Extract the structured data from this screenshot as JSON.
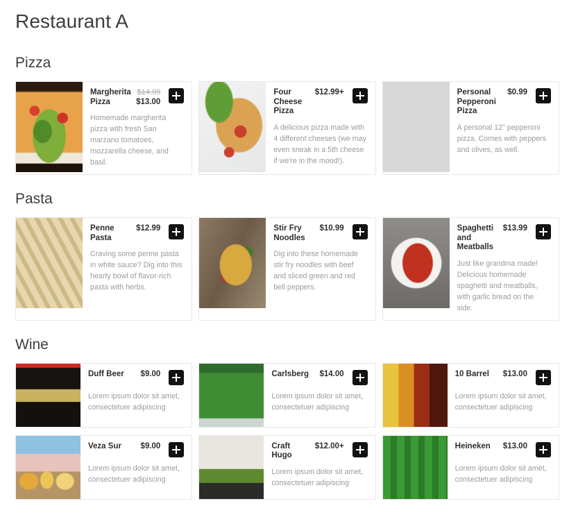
{
  "restaurant": {
    "title": "Restaurant A"
  },
  "add_button_label": "+",
  "sections": [
    {
      "id": "pizza",
      "title": "Pizza",
      "card_size": "tall",
      "items": [
        {
          "name": "Margherita Pizza",
          "price": "$13.00",
          "old_price": "$14.99",
          "description": "Homemade margherita pizza with fresh San marzano tomatoes, mozzarella cheese, and basil.",
          "thumb": "margherita"
        },
        {
          "name": "Four Cheese Pizza",
          "price": "$12.99+",
          "old_price": "",
          "description": "A delicious pizza made with 4 different cheeses (we may even sneak in a 5th cheese if we're in the mood!).",
          "thumb": "fourcheese"
        },
        {
          "name": "Personal Pepperoni Pizza",
          "price": "$0.99",
          "old_price": "",
          "description": "A personal 12\" pepperoni pizza. Comes with peppers and olives, as well.",
          "thumb": "pepperoni"
        }
      ]
    },
    {
      "id": "pasta",
      "title": "Pasta",
      "card_size": "tall",
      "items": [
        {
          "name": "Penne Pasta",
          "price": "$12.99",
          "old_price": "",
          "description": "Craving some penne pasta in white sauce? Dig into this hearty bowl of flavor-rich pasta with herbs.",
          "thumb": "penne"
        },
        {
          "name": "Stir Fry Noodles",
          "price": "$10.99",
          "old_price": "",
          "description": "Dig into these homemade stir fry noodles with beef and sliced green and red bell peppers.",
          "thumb": "stirfry"
        },
        {
          "name": "Spaghetti and Meatballs",
          "price": "$13.99",
          "old_price": "",
          "description": "Just like grandma made! Delicious homemade spaghetti and meatballs, with garlic bread on the side.",
          "thumb": "spaghetti"
        }
      ]
    },
    {
      "id": "wine",
      "title": "Wine",
      "card_size": "short",
      "items": [
        {
          "name": "Duff Beer",
          "price": "$9.00",
          "old_price": "",
          "description": "Lorem ipsum dolor sit amet, consectetuer adipiscing",
          "thumb": "duff"
        },
        {
          "name": "Carlsberg",
          "price": "$14.00",
          "old_price": "",
          "description": "Lorem ipsum dolor sit amet, consectetuer adipiscing",
          "thumb": "carlsberg"
        },
        {
          "name": "10 Barrel",
          "price": "$13.00",
          "old_price": "",
          "description": "Lorem ipsum dolor sit amet, consectetuer adipiscing",
          "thumb": "10barrel"
        },
        {
          "name": "Veza Sur",
          "price": "$9.00",
          "old_price": "",
          "description": "Lorem ipsum dolor sit amet, consectetuer adipiscing",
          "thumb": "vezasur"
        },
        {
          "name": "Craft Hugo",
          "price": "$12.00+",
          "old_price": "",
          "description": "Lorem ipsum dolor sit amet, consectetuer adipiscing",
          "thumb": "crafthugo"
        },
        {
          "name": "Heineken",
          "price": "$13.00",
          "old_price": "",
          "description": "Lorem ipsum dolor sit amet, consectetuer adipiscing",
          "thumb": "heineken"
        }
      ]
    }
  ],
  "colors": {
    "page_background": "#ffffff",
    "title_text": "#3d3d3d",
    "item_name_text": "#2d2d2d",
    "description_text": "#9b9b9b",
    "old_price_text": "#a8a8a8",
    "card_border": "#e8e8e8",
    "add_button_background": "#121212",
    "add_button_glyph": "#ffffff"
  }
}
